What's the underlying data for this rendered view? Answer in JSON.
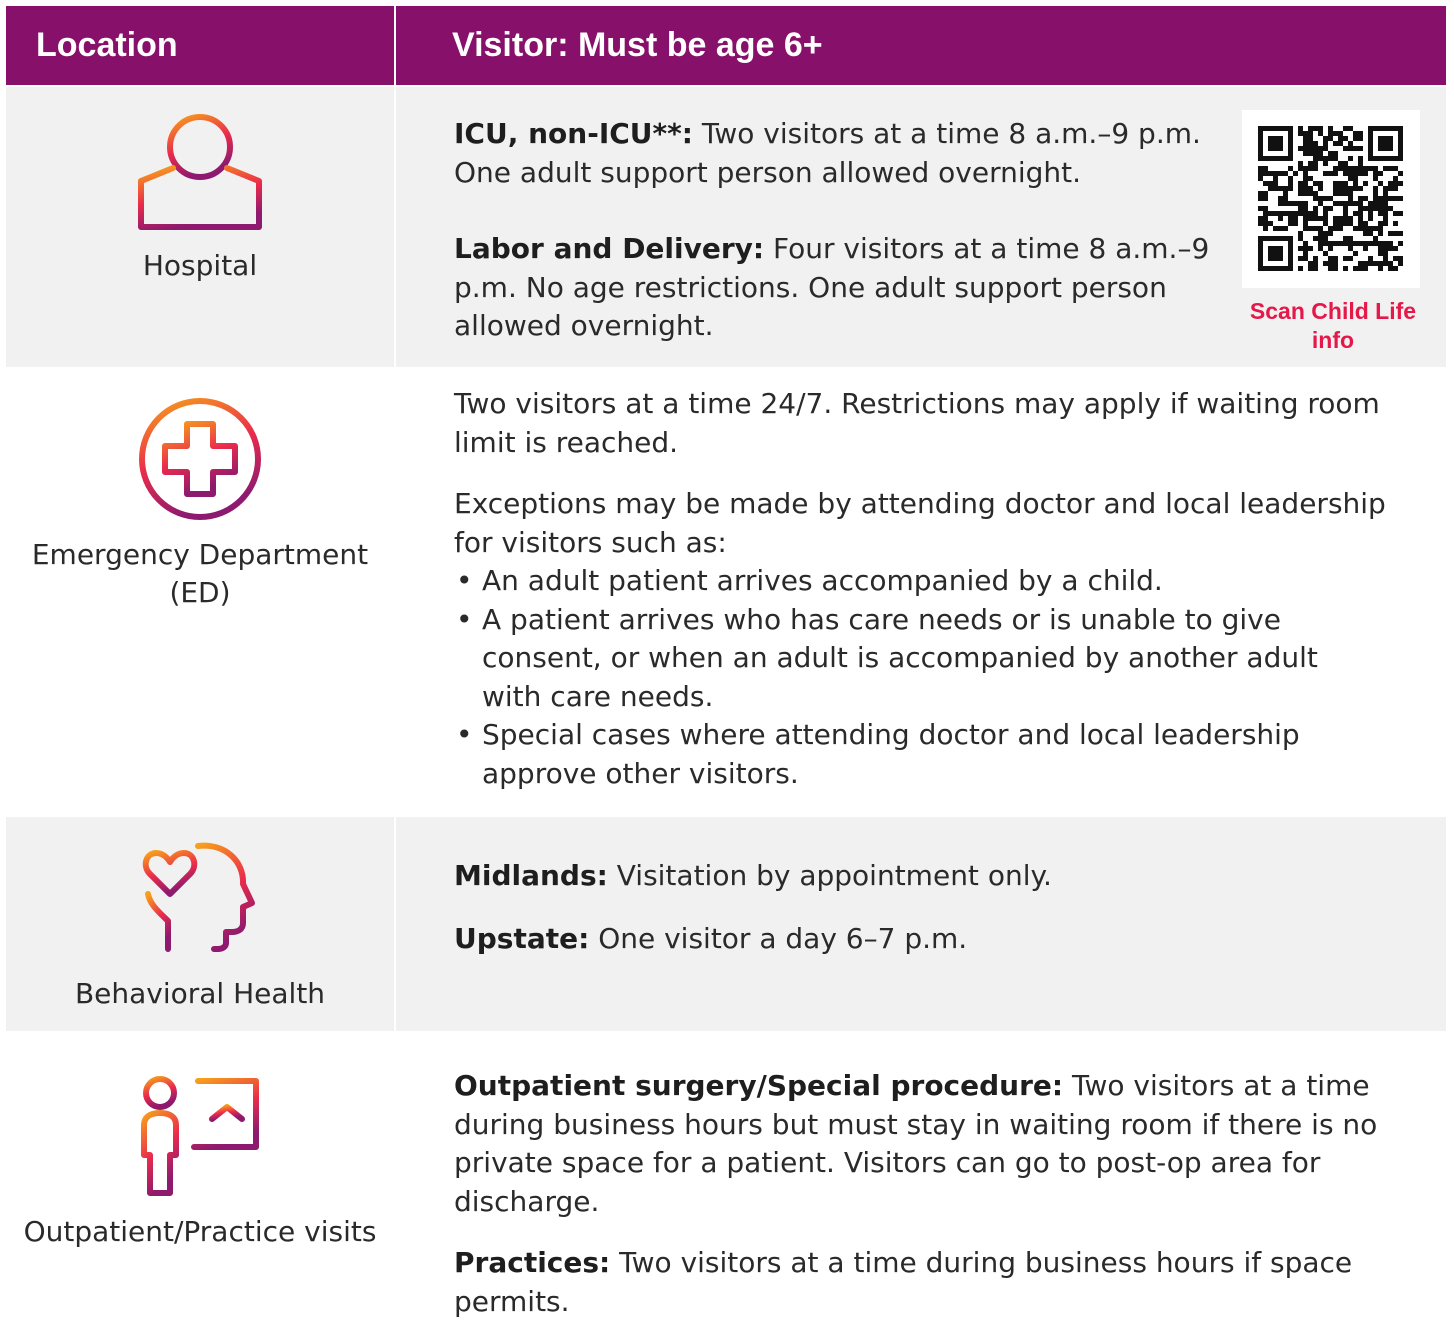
{
  "header": {
    "location": "Location",
    "visitor": "Visitor: Must be age 6+"
  },
  "rows": [
    {
      "location": "Hospital",
      "icon": "hospital-building-icon",
      "paragraphs": [
        {
          "bold": "ICU, non-ICU**:",
          "text": " Two visitors at a time 8 a.m.–9 p.m. One adult support person allowed overnight."
        },
        {
          "bold": "Labor and Delivery:",
          "text": " Four visitors at a time 8 a.m.–9 p.m. No age restrictions. One adult support person allowed overnight."
        }
      ],
      "qr": {
        "icon": "qr-code-icon",
        "caption": "Scan Child Life info"
      }
    },
    {
      "location": "Emergency Department (ED)",
      "icon": "medical-cross-circle-icon",
      "paragraphs": [
        {
          "text": "Two visitors at a time 24/7. Restrictions may apply if waiting room limit is reached."
        },
        {
          "text": "Exceptions may be made by attending doctor and local leadership for visitors such as:"
        }
      ],
      "bullets": [
        "An adult patient arrives accompanied by a child.",
        "A patient arrives who has care needs or is unable to give consent, or when an adult is accompanied by another adult with care needs.",
        "Special cases where attending doctor and local leadership approve other visitors."
      ]
    },
    {
      "location": "Behavioral Health",
      "icon": "heart-head-icon",
      "paragraphs": [
        {
          "bold": "Midlands:",
          "text": " Visitation by appointment only."
        },
        {
          "bold": "Upstate:",
          "text": " One visitor a day 6–7 p.m."
        }
      ]
    },
    {
      "location": "Outpatient/Practice visits",
      "icon": "person-xray-icon",
      "paragraphs": [
        {
          "bold": "Outpatient surgery/Special procedure:",
          "text": " Two visitors at a time during business hours but must stay in waiting room if there is no private space for a patient. Visitors can go to post-op area for discharge."
        },
        {
          "bold": "Practices:",
          "text": " Two visitors at a time during business hours if space permits."
        }
      ]
    }
  ],
  "colors": {
    "header": "#87106a",
    "accent_red": "#e5184a",
    "icon_orange": "#f39b1f",
    "icon_purple": "#8d1a6e",
    "row_shade": "#f1f1f1"
  }
}
